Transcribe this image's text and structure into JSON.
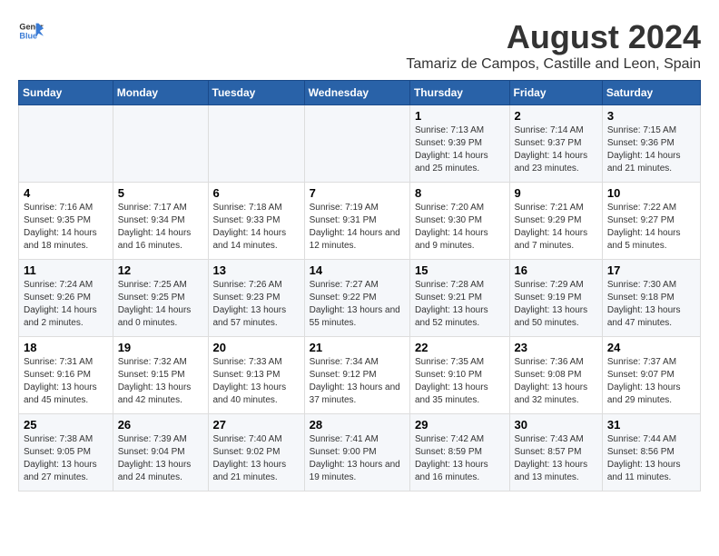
{
  "header": {
    "logo_general": "General",
    "logo_blue": "Blue",
    "title": "August 2024",
    "subtitle": "Tamariz de Campos, Castille and Leon, Spain"
  },
  "days_of_week": [
    "Sunday",
    "Monday",
    "Tuesday",
    "Wednesday",
    "Thursday",
    "Friday",
    "Saturday"
  ],
  "weeks": [
    [
      {
        "day": "",
        "info": ""
      },
      {
        "day": "",
        "info": ""
      },
      {
        "day": "",
        "info": ""
      },
      {
        "day": "",
        "info": ""
      },
      {
        "day": "1",
        "info": "Sunrise: 7:13 AM\nSunset: 9:39 PM\nDaylight: 14 hours and 25 minutes."
      },
      {
        "day": "2",
        "info": "Sunrise: 7:14 AM\nSunset: 9:37 PM\nDaylight: 14 hours and 23 minutes."
      },
      {
        "day": "3",
        "info": "Sunrise: 7:15 AM\nSunset: 9:36 PM\nDaylight: 14 hours and 21 minutes."
      }
    ],
    [
      {
        "day": "4",
        "info": "Sunrise: 7:16 AM\nSunset: 9:35 PM\nDaylight: 14 hours and 18 minutes."
      },
      {
        "day": "5",
        "info": "Sunrise: 7:17 AM\nSunset: 9:34 PM\nDaylight: 14 hours and 16 minutes."
      },
      {
        "day": "6",
        "info": "Sunrise: 7:18 AM\nSunset: 9:33 PM\nDaylight: 14 hours and 14 minutes."
      },
      {
        "day": "7",
        "info": "Sunrise: 7:19 AM\nSunset: 9:31 PM\nDaylight: 14 hours and 12 minutes."
      },
      {
        "day": "8",
        "info": "Sunrise: 7:20 AM\nSunset: 9:30 PM\nDaylight: 14 hours and 9 minutes."
      },
      {
        "day": "9",
        "info": "Sunrise: 7:21 AM\nSunset: 9:29 PM\nDaylight: 14 hours and 7 minutes."
      },
      {
        "day": "10",
        "info": "Sunrise: 7:22 AM\nSunset: 9:27 PM\nDaylight: 14 hours and 5 minutes."
      }
    ],
    [
      {
        "day": "11",
        "info": "Sunrise: 7:24 AM\nSunset: 9:26 PM\nDaylight: 14 hours and 2 minutes."
      },
      {
        "day": "12",
        "info": "Sunrise: 7:25 AM\nSunset: 9:25 PM\nDaylight: 14 hours and 0 minutes."
      },
      {
        "day": "13",
        "info": "Sunrise: 7:26 AM\nSunset: 9:23 PM\nDaylight: 13 hours and 57 minutes."
      },
      {
        "day": "14",
        "info": "Sunrise: 7:27 AM\nSunset: 9:22 PM\nDaylight: 13 hours and 55 minutes."
      },
      {
        "day": "15",
        "info": "Sunrise: 7:28 AM\nSunset: 9:21 PM\nDaylight: 13 hours and 52 minutes."
      },
      {
        "day": "16",
        "info": "Sunrise: 7:29 AM\nSunset: 9:19 PM\nDaylight: 13 hours and 50 minutes."
      },
      {
        "day": "17",
        "info": "Sunrise: 7:30 AM\nSunset: 9:18 PM\nDaylight: 13 hours and 47 minutes."
      }
    ],
    [
      {
        "day": "18",
        "info": "Sunrise: 7:31 AM\nSunset: 9:16 PM\nDaylight: 13 hours and 45 minutes."
      },
      {
        "day": "19",
        "info": "Sunrise: 7:32 AM\nSunset: 9:15 PM\nDaylight: 13 hours and 42 minutes."
      },
      {
        "day": "20",
        "info": "Sunrise: 7:33 AM\nSunset: 9:13 PM\nDaylight: 13 hours and 40 minutes."
      },
      {
        "day": "21",
        "info": "Sunrise: 7:34 AM\nSunset: 9:12 PM\nDaylight: 13 hours and 37 minutes."
      },
      {
        "day": "22",
        "info": "Sunrise: 7:35 AM\nSunset: 9:10 PM\nDaylight: 13 hours and 35 minutes."
      },
      {
        "day": "23",
        "info": "Sunrise: 7:36 AM\nSunset: 9:08 PM\nDaylight: 13 hours and 32 minutes."
      },
      {
        "day": "24",
        "info": "Sunrise: 7:37 AM\nSunset: 9:07 PM\nDaylight: 13 hours and 29 minutes."
      }
    ],
    [
      {
        "day": "25",
        "info": "Sunrise: 7:38 AM\nSunset: 9:05 PM\nDaylight: 13 hours and 27 minutes."
      },
      {
        "day": "26",
        "info": "Sunrise: 7:39 AM\nSunset: 9:04 PM\nDaylight: 13 hours and 24 minutes."
      },
      {
        "day": "27",
        "info": "Sunrise: 7:40 AM\nSunset: 9:02 PM\nDaylight: 13 hours and 21 minutes."
      },
      {
        "day": "28",
        "info": "Sunrise: 7:41 AM\nSunset: 9:00 PM\nDaylight: 13 hours and 19 minutes."
      },
      {
        "day": "29",
        "info": "Sunrise: 7:42 AM\nSunset: 8:59 PM\nDaylight: 13 hours and 16 minutes."
      },
      {
        "day": "30",
        "info": "Sunrise: 7:43 AM\nSunset: 8:57 PM\nDaylight: 13 hours and 13 minutes."
      },
      {
        "day": "31",
        "info": "Sunrise: 7:44 AM\nSunset: 8:56 PM\nDaylight: 13 hours and 11 minutes."
      }
    ]
  ]
}
